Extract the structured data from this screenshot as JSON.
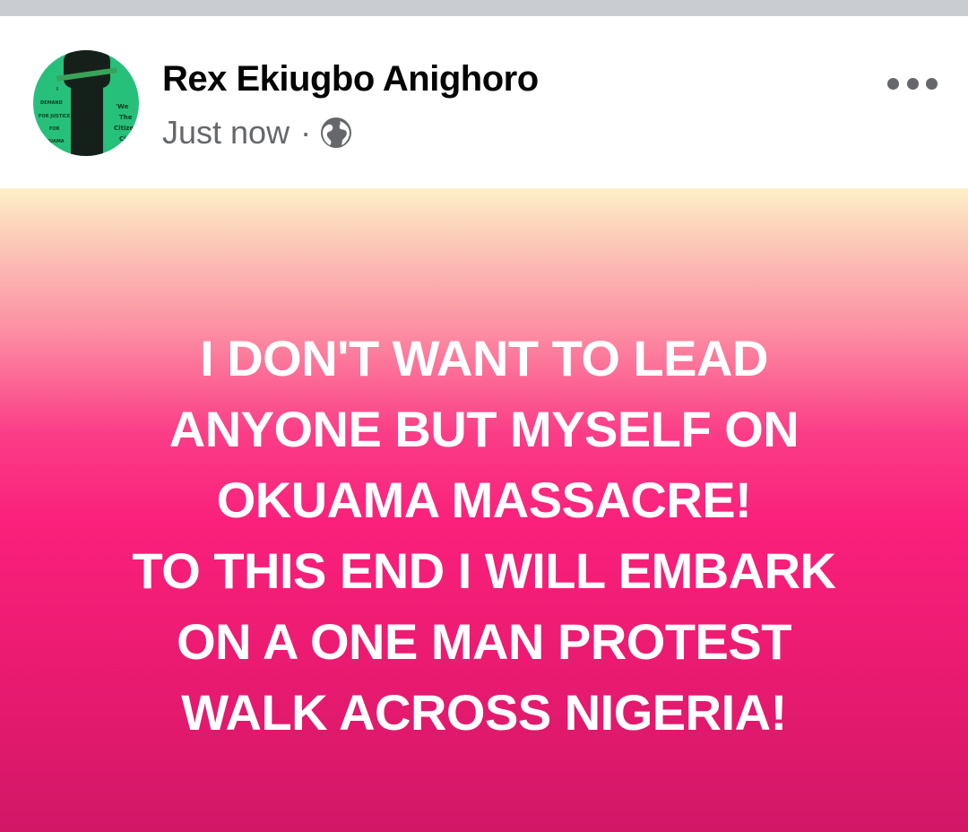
{
  "post": {
    "author": "Rex Ekiugbo Anighoro",
    "timestamp": "Just now",
    "separator": "·",
    "privacy_icon": "globe-icon",
    "more_icon": "more-options-icon",
    "avatar": {
      "text_left": [
        "I",
        "DEMAND",
        "FOR JUSTICE",
        "FOR",
        "OKUAMA"
      ],
      "text_right": [
        "'We",
        "The",
        "Citizen",
        "Ci"
      ]
    },
    "body_lines": [
      "I DON'T WANT TO LEAD",
      "ANYONE BUT MYSELF ON",
      "OKUAMA MASSACRE!",
      "TO THIS END I WILL EMBARK",
      "ON A ONE MAN PROTEST",
      "WALK ACROSS NIGERIA!"
    ]
  },
  "colors": {
    "background_gradient_top": "#fdf0c7",
    "background_gradient_mid": "#fa207b",
    "background_gradient_bottom": "#d21767",
    "text": "#ffffff"
  }
}
